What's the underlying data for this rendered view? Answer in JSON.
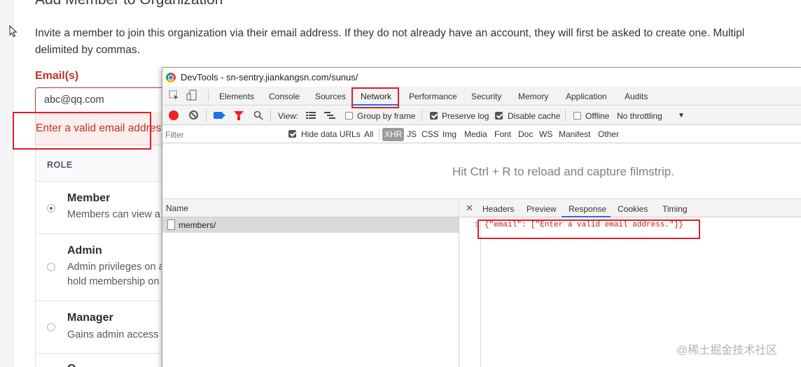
{
  "page": {
    "title": "Add Member to Organization",
    "description_line1": "Invite a member to join this organization via their email address. If they do not already have an account, they will first be asked to create one. Multipl",
    "description_line2": "delimited by commas.",
    "email_label": "Email(s)",
    "email_value": "abc@qq.com",
    "email_error": "Enter a valid email address.",
    "role_header": "ROLE",
    "roles": [
      {
        "name": "Member",
        "desc": "Members can view a",
        "desc2": "",
        "checked": true
      },
      {
        "name": "Admin",
        "desc": "Admin privileges on a",
        "desc2": "hold membership on",
        "checked": false
      },
      {
        "name": "Manager",
        "desc": "Gains admin access",
        "desc2": "",
        "checked": false
      },
      {
        "name": "O",
        "desc": "",
        "desc2": "",
        "checked": false
      }
    ]
  },
  "devtools": {
    "window_title": "DevTools - sn-sentry.jiankangsn.com/sunus/",
    "tabs": [
      "Elements",
      "Console",
      "Sources",
      "Network",
      "Performance",
      "Security",
      "Memory",
      "Application",
      "Audits"
    ],
    "active_tab": "Network",
    "toolbar": {
      "view_label": "View:",
      "group_by_frame": "Group by frame",
      "preserve_log": "Preserve log",
      "disable_cache": "Disable cache",
      "offline": "Offline",
      "throttling": "No throttling"
    },
    "filter": {
      "placeholder": "Filter",
      "hide_data_urls": "Hide data URLs",
      "types": [
        "All",
        "XHR",
        "JS",
        "CSS",
        "Img",
        "Media",
        "Font",
        "Doc",
        "WS",
        "Manifest",
        "Other"
      ],
      "active_type": "XHR"
    },
    "filmstrip_hint": "Hit Ctrl + R to reload and capture filmstrip.",
    "name_header": "Name",
    "requests": [
      "members/"
    ],
    "detail_tabs": [
      "Headers",
      "Preview",
      "Response",
      "Cookies",
      "Timing"
    ],
    "active_detail_tab": "Response",
    "response_line_no": "1",
    "response_body": "{\"email\": [\"Enter a valid email address.\"]}"
  },
  "watermark": "@稀土掘金技术社区"
}
